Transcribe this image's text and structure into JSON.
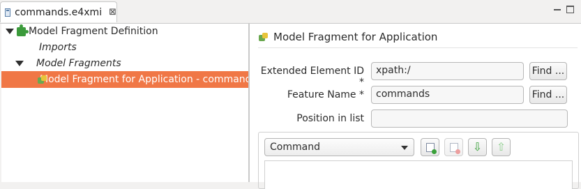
{
  "tab": {
    "label": "commands.e4xmi",
    "close": "⊠"
  },
  "tree": {
    "root": "Model Fragment Definition",
    "imports": "Imports",
    "fragments": "Model Fragments",
    "selected_item": "Model Fragment for Application - command"
  },
  "details": {
    "title": "Model Fragment for Application",
    "fields": {
      "extended_id": {
        "label": "Extended Element ID *",
        "value": "xpath:/",
        "button": "Find ..."
      },
      "feature_name": {
        "label": "Feature Name *",
        "value": "commands",
        "button": "Find ..."
      },
      "position": {
        "label": "Position in list",
        "value": ""
      }
    },
    "type_select": "Command"
  },
  "colors": {
    "selection": "#f07746",
    "add": "#3aa13a",
    "remove": "#e06060"
  }
}
